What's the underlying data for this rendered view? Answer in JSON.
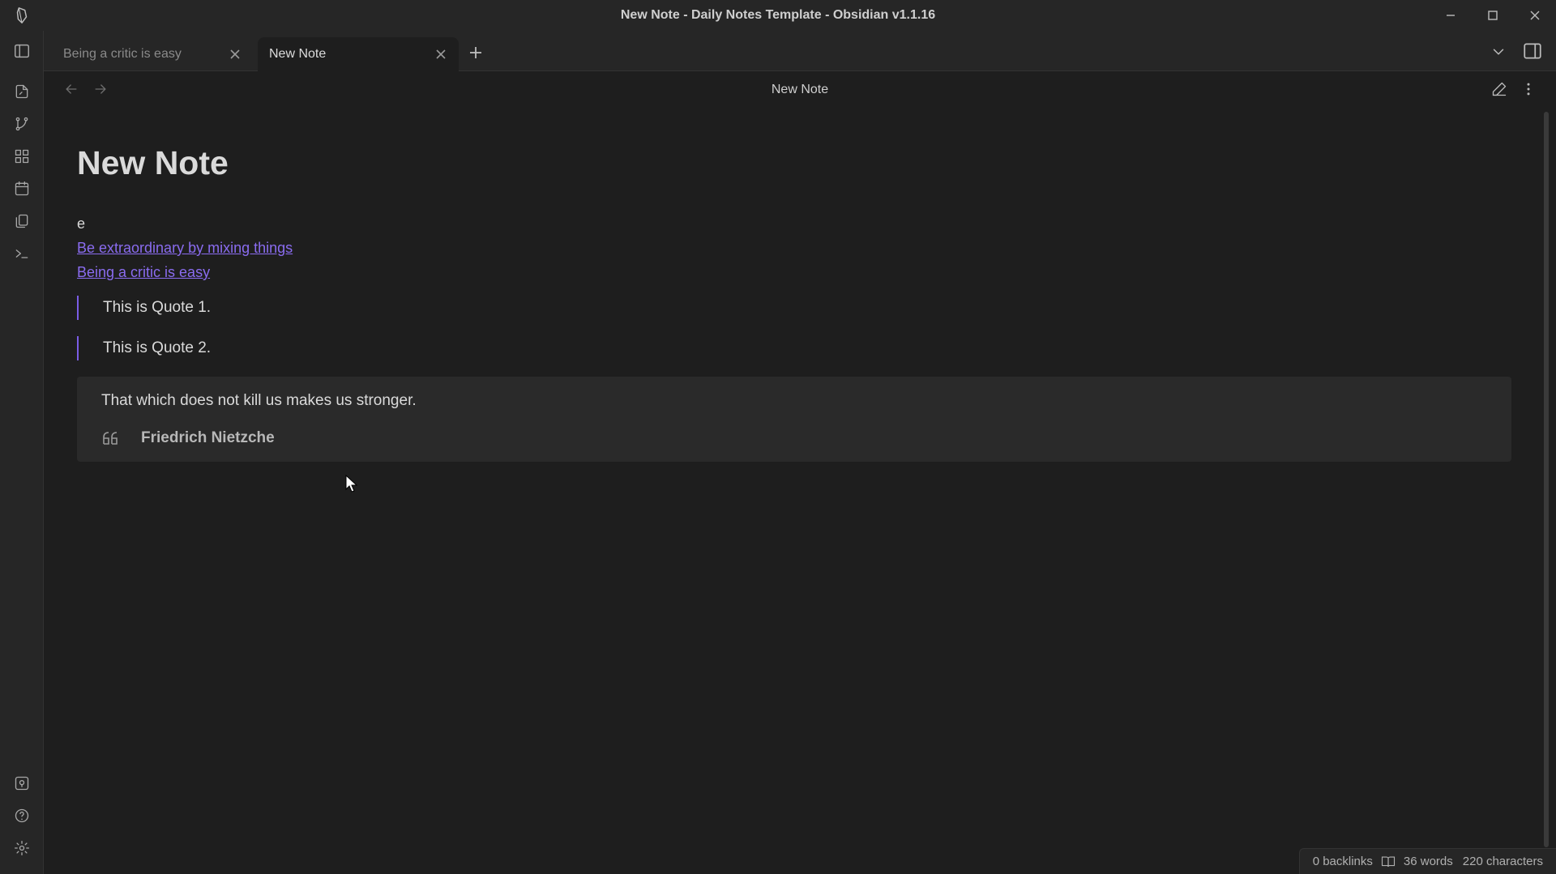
{
  "window": {
    "title": "New Note - Daily Notes Template - Obsidian v1.1.16"
  },
  "tabs": [
    {
      "label": "Being a critic is easy",
      "active": false
    },
    {
      "label": "New Note",
      "active": true
    }
  ],
  "view_header": {
    "title": "New Note"
  },
  "note": {
    "title": "New Note",
    "paragraph": "e",
    "links": [
      "Be extraordinary by mixing things",
      "Being a critic is easy"
    ],
    "blockquotes": [
      "This is Quote 1.",
      "This is Quote 2."
    ],
    "quote_callout": {
      "text": "That which does not kill us makes us stronger.",
      "author": "Friedrich Nietzche"
    }
  },
  "status_bar": {
    "backlinks": "0 backlinks",
    "words": "36 words",
    "characters": "220 characters"
  },
  "colors": {
    "accent": "#8a6cf0",
    "background": "#1e1e1e",
    "panel": "#262626"
  },
  "ribbon_icons": [
    "open-quick-switcher-icon",
    "graph-view-icon",
    "canvas-icon",
    "daily-note-calendar-icon",
    "templates-icon",
    "command-palette-icon",
    "vault-switcher-icon",
    "help-icon",
    "settings-icon"
  ]
}
